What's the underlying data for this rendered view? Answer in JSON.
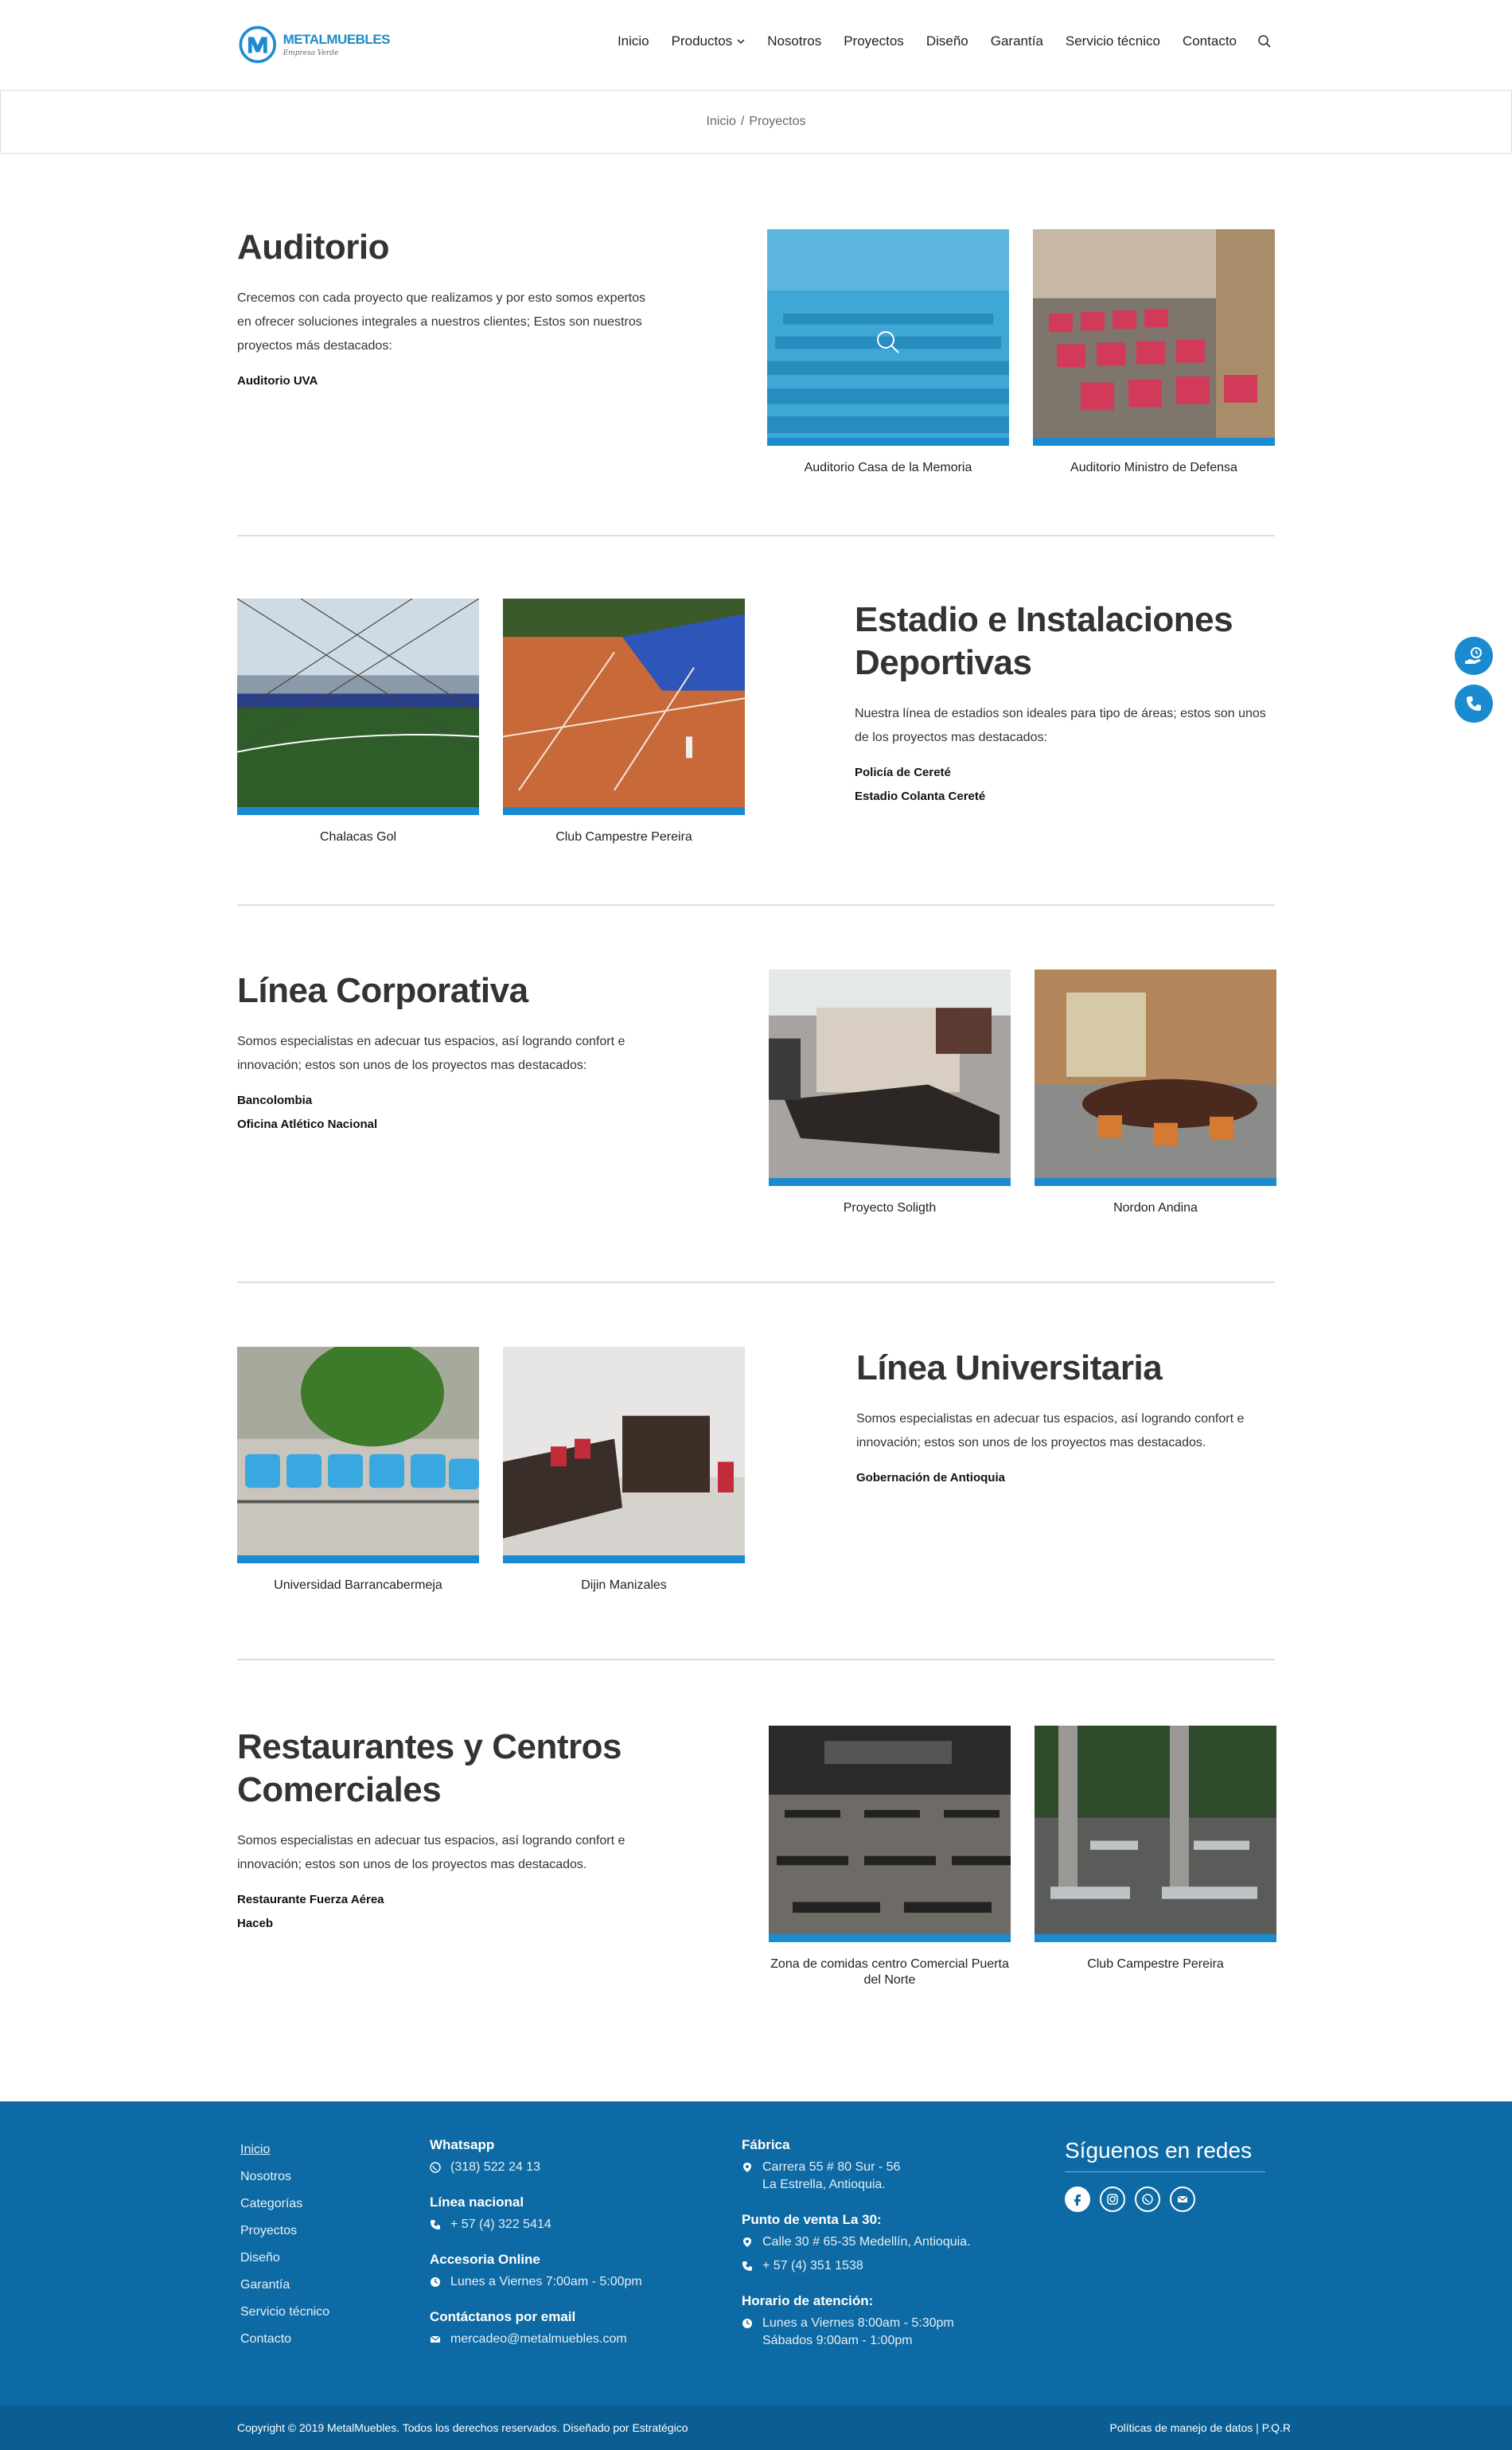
{
  "brand": {
    "name": "METALMUEBLES",
    "tagline": "Empresa Verde",
    "colors": {
      "primary": "#1a8bd1",
      "footer": "#0d6aa4",
      "bottom_bar": "#0b5e93"
    }
  },
  "nav": {
    "items": [
      "Inicio",
      "Productos",
      "Nosotros",
      "Proyectos",
      "Diseño",
      "Garantía",
      "Servicio técnico",
      "Contacto"
    ],
    "search_icon": "search-icon"
  },
  "breadcrumb": {
    "home": "Inicio",
    "separator": "/",
    "current": "Proyectos"
  },
  "sections": [
    {
      "title": "Auditorio",
      "description": "Crecemos con cada proyecto que realizamos y por esto somos expertos en ofrecer soluciones integrales a nuestros clientes; Estos son nuestros proyectos más destacados:",
      "projects": [
        "Auditorio UVA"
      ],
      "cards": [
        "Auditorio Casa de la Memoria",
        "Auditorio Ministro de Defensa"
      ]
    },
    {
      "title": "Estadio e Instalaciones Deportivas",
      "description": "Nuestra línea de estadios son ideales para tipo de áreas; estos son unos de los proyectos mas destacados:",
      "projects": [
        "Policía de Cereté",
        "Estadio Colanta Cereté"
      ],
      "cards": [
        "Chalacas Gol",
        "Club Campestre Pereira"
      ]
    },
    {
      "title": "Línea Corporativa",
      "description": "Somos especialistas en adecuar tus espacios, así logrando confort e innovación; estos son unos de los proyectos mas destacados:",
      "projects": [
        "Bancolombia",
        "Oficina Atlético Nacional"
      ],
      "cards": [
        "Proyecto Soligth",
        "Nordon Andina"
      ]
    },
    {
      "title": "Línea Universitaria",
      "description": "Somos especialistas en adecuar tus espacios, así logrando confort e innovación; estos son unos de los proyectos mas destacados.",
      "projects": [
        "Gobernación de Antioquia"
      ],
      "cards": [
        "Universidad Barrancabermeja",
        "Dijin Manizales"
      ]
    },
    {
      "title": "Restaurantes y Centros Comerciales",
      "description": "Somos especialistas en adecuar tus espacios, así logrando confort e innovación; estos son unos de los proyectos mas destacados.",
      "projects": [
        "Restaurante Fuerza Aérea",
        "Haceb"
      ],
      "cards": [
        "Zona de comidas centro Comercial Puerta del Norte",
        "Club Campestre Pereira"
      ]
    }
  ],
  "footer": {
    "links": [
      "Inicio",
      "Nosotros",
      "Categorías",
      "Proyectos",
      "Diseño",
      "Garantía",
      "Servicio técnico",
      "Contacto"
    ],
    "whatsapp_title": "Whatsapp",
    "whatsapp": "(318) 522 24 13",
    "linea_title": "Línea nacional",
    "linea": "+ 57 (4) 322 5414",
    "accesoria_title": "Accesoria Online",
    "accesoria": "Lunes a Viernes 7:00am - 5:00pm",
    "email_title": "Contáctanos por email",
    "email": "mercadeo@metalmuebles.com",
    "fabrica_title": "Fábrica",
    "fabrica_line1": "Carrera 55 # 80 Sur - 56",
    "fabrica_line2": "La Estrella, Antioquia.",
    "punto_title": "Punto de venta La 30:",
    "punto_address": "Calle 30 # 65-35 Medellín, Antioquia.",
    "punto_phone": "+ 57 (4) 351 1538",
    "horario_title": "Horario de atención:",
    "horario_line1": "Lunes a Viernes 8:00am - 5:30pm",
    "horario_line2": "Sábados 9:00am - 1:00pm",
    "social_title": "Síguenos en redes",
    "socials": [
      "facebook-icon",
      "instagram-icon",
      "whatsapp-icon",
      "email-icon"
    ]
  },
  "bottom": {
    "copyright": "Copyright © 2019 MetalMuebles. Todos los derechos reservados. Diseñado por Estratégico",
    "policy": "Políticas de manejo de datos",
    "separator": "|",
    "pqr": "P.Q.R"
  }
}
